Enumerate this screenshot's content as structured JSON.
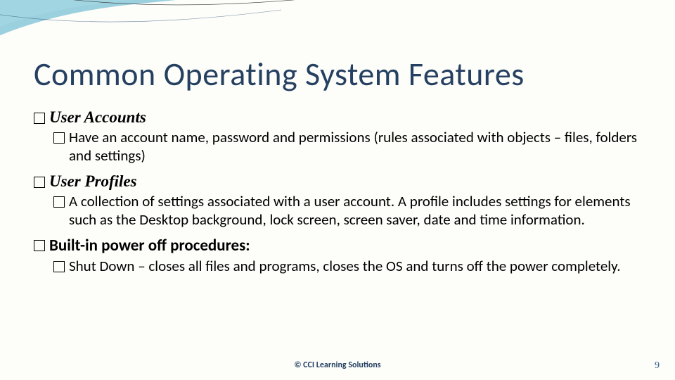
{
  "title": "Common Operating System Features",
  "bullets": [
    {
      "heading": "User Accounts",
      "sub": "Have an account name, password and permissions (rules associated with objects – files, folders and settings)"
    },
    {
      "heading": "User Profiles",
      "sub": "A collection of settings associated with a  user account. A profile includes settings for elements such as the Desktop background, lock screen, screen saver, date and time information."
    },
    {
      "heading": "Built-in power off procedures:",
      "sub": "Shut Down – closes all files and programs, closes the OS and turns off the power completely."
    }
  ],
  "footer": {
    "copyright": "© CCI Learning Solutions",
    "page": "9"
  }
}
